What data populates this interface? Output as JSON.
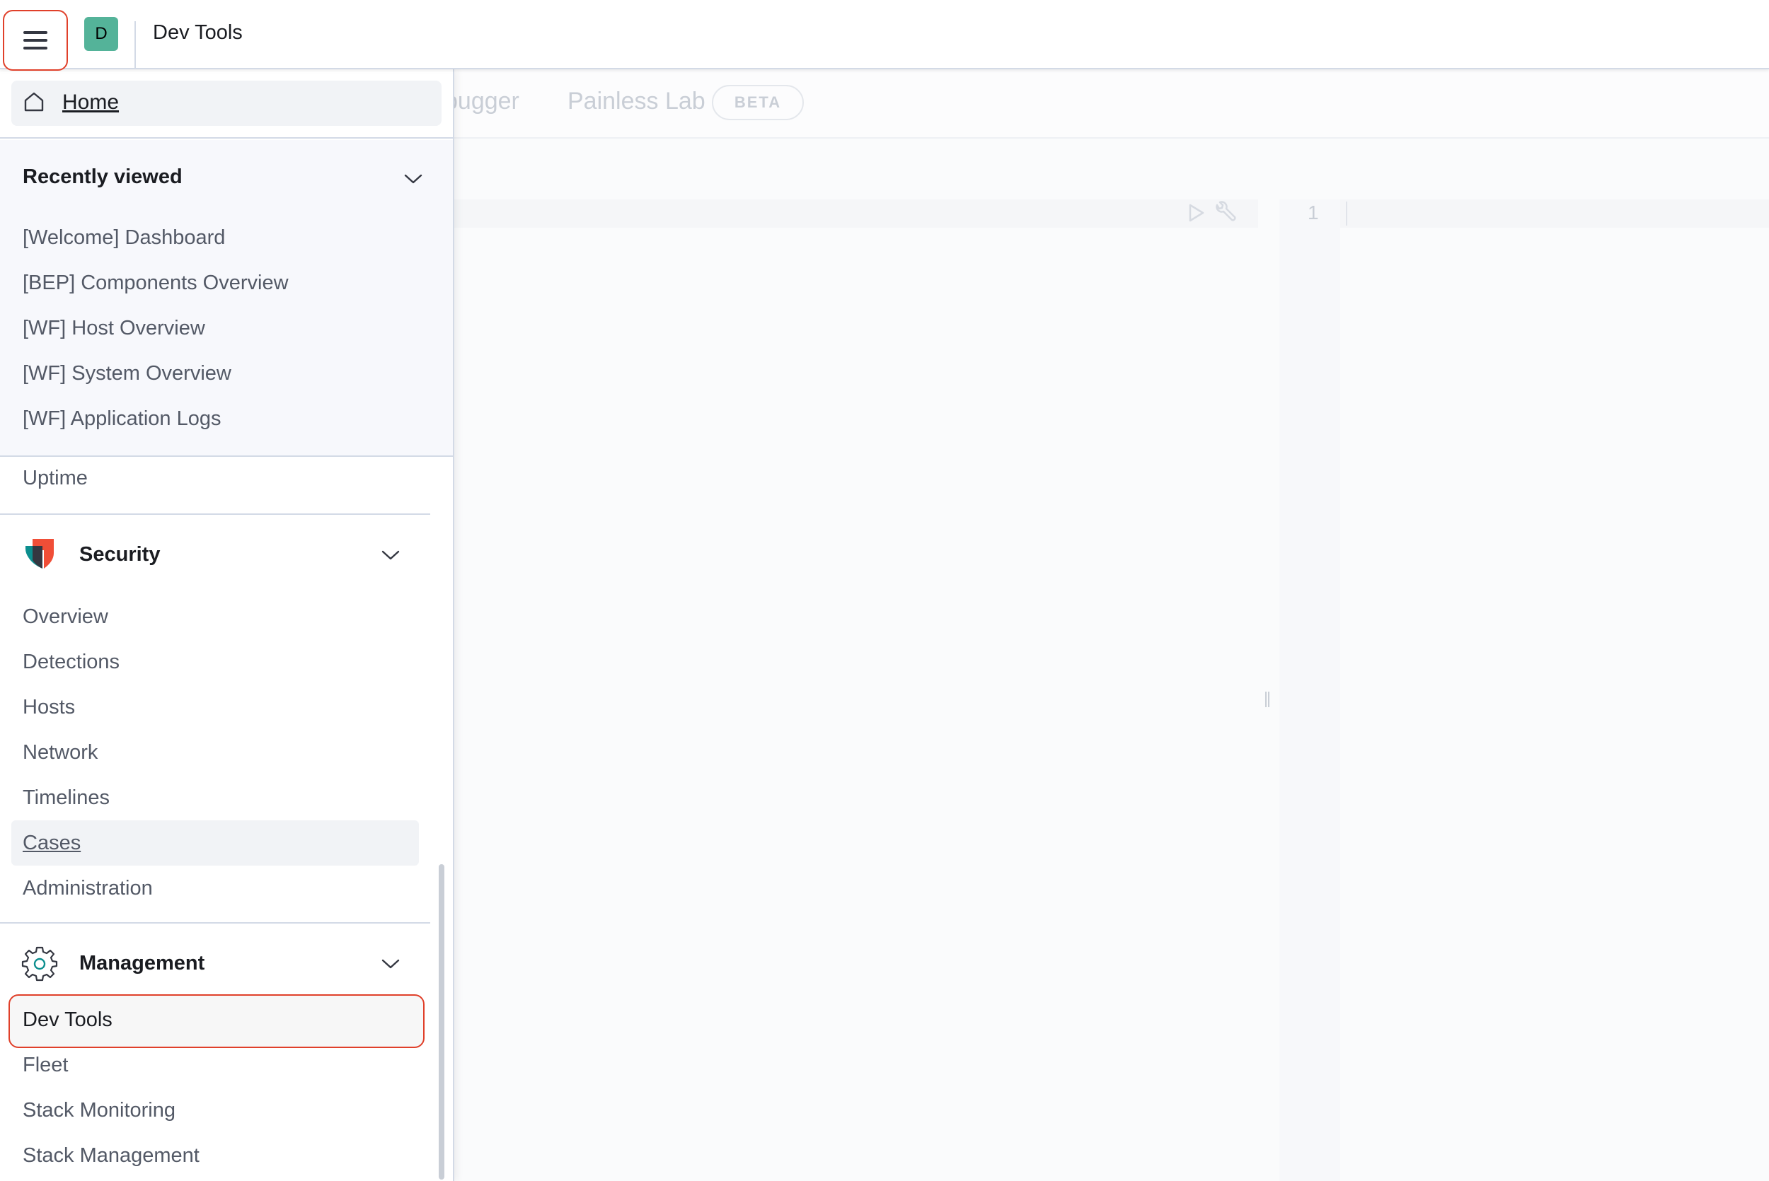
{
  "header": {
    "space_initial": "D",
    "title": "Dev Tools"
  },
  "background": {
    "tabs": [
      {
        "label": "bugger"
      },
      {
        "label": "Painless Lab"
      }
    ],
    "beta_badge": "BETA",
    "editor_line_number": "1"
  },
  "sidenav": {
    "home_label": "Home",
    "recently_viewed": {
      "title": "Recently viewed",
      "items": [
        {
          "label": "[Welcome] Dashboard"
        },
        {
          "label": "[BEP] Components Overview"
        },
        {
          "label": "[WF] Host Overview"
        },
        {
          "label": "[WF] System Overview"
        },
        {
          "label": "[WF] Application Logs"
        }
      ]
    },
    "uptime_label": "Uptime",
    "security": {
      "title": "Security",
      "items": [
        {
          "label": "Overview"
        },
        {
          "label": "Detections"
        },
        {
          "label": "Hosts"
        },
        {
          "label": "Network"
        },
        {
          "label": "Timelines"
        },
        {
          "label": "Cases"
        },
        {
          "label": "Administration"
        }
      ]
    },
    "management": {
      "title": "Management",
      "items": [
        {
          "label": "Dev Tools"
        },
        {
          "label": "Fleet"
        },
        {
          "label": "Stack Monitoring"
        },
        {
          "label": "Stack Management"
        }
      ]
    }
  },
  "colors": {
    "highlight": "#e0402a",
    "space_avatar": "#54b399",
    "security_orange": "#f04e37",
    "security_teal": "#0b8e8e"
  }
}
